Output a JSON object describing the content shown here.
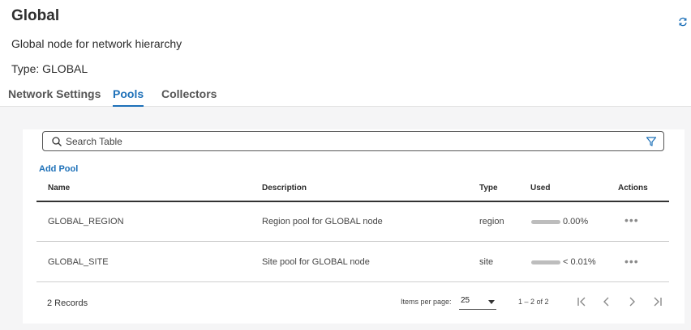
{
  "header": {
    "title": "Global",
    "subtitle": "Global node for network hierarchy",
    "type_line": "Type: GLOBAL"
  },
  "tabs": [
    {
      "label": "Network Settings",
      "active": false
    },
    {
      "label": "Pools",
      "active": true
    },
    {
      "label": "Collectors",
      "active": false
    }
  ],
  "search": {
    "placeholder": "Search Table"
  },
  "add_pool_label": "Add Pool",
  "table": {
    "columns": [
      "Name",
      "Description",
      "Type",
      "Used",
      "Actions"
    ],
    "rows": [
      {
        "name": "GLOBAL_REGION",
        "description": "Region pool for GLOBAL node",
        "type": "region",
        "used": "0.00%",
        "actions": "•••"
      },
      {
        "name": "GLOBAL_SITE",
        "description": "Site pool for GLOBAL node",
        "type": "site",
        "used": "< 0.01%",
        "actions": "•••"
      }
    ]
  },
  "footer": {
    "records": "2 Records",
    "items_per_page_label": "Items per page:",
    "items_per_page": "25",
    "range": "1 – 2 of 2"
  },
  "colors": {
    "accent": "#1d70b8",
    "bar": "#bdbdbd"
  },
  "icons": [
    "refresh-icon",
    "search-icon",
    "filter-icon",
    "first-page-icon",
    "prev-page-icon",
    "next-page-icon",
    "last-page-icon"
  ]
}
